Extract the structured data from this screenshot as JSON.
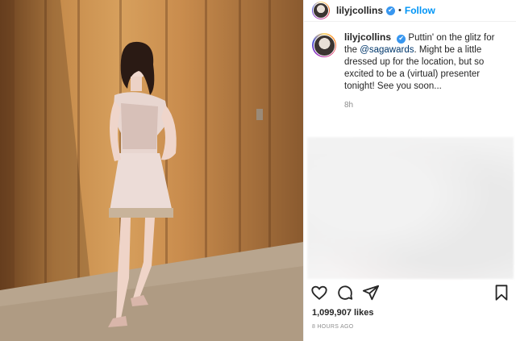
{
  "post": {
    "username": "lilyjcollins",
    "follow_label": "Follow",
    "dot": "•",
    "verified_mark": "✔",
    "caption": {
      "username": "lilyjcollins",
      "text_before_mention": " Puttin' on the glitz for the ",
      "mention": "@sagawards",
      "text_after_mention": ". Might be a little dressed up for the location, but so excited to be a (virtual) presenter tonight! See you soon...",
      "time": "8h"
    },
    "likes": "1,099,907 likes",
    "posted": "8 HOURS AGO",
    "icons": [
      "heart-icon",
      "comment-icon",
      "share-icon",
      "bookmark-icon"
    ],
    "colors": {
      "follow": "#0095f6",
      "verified": "#3897f0",
      "secondary_text": "#8e8e8e"
    }
  }
}
